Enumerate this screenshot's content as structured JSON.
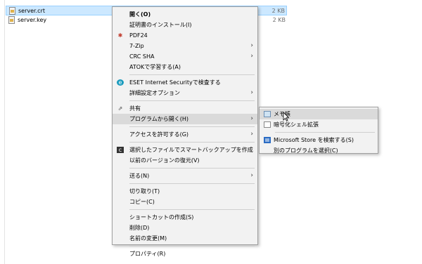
{
  "files": [
    {
      "name": "server.crt",
      "size": "2 KB",
      "selected": true
    },
    {
      "name": "server.key",
      "size": "2 KB",
      "selected": false
    }
  ],
  "menu": {
    "open": "開く(O)",
    "install_cert": "証明書のインストール(I)",
    "pdf24": "PDF24",
    "sevenzip": "7-Zip",
    "crc_sha": "CRC SHA",
    "atok": "ATOKで学習する(A)",
    "eset_scan": "ESET Internet Securityで検査する",
    "eset_advanced": "詳細設定オプション",
    "share": "共有",
    "open_with": "プログラムから開く(H)",
    "give_access": "アクセスを許可する(G)",
    "smart_backup": "選択したファイルでスマートバックアップを作成",
    "restore_versions": "以前のバージョンの復元(V)",
    "send_to": "送る(N)",
    "cut": "切り取り(T)",
    "copy": "コピー(C)",
    "create_shortcut": "ショートカットの作成(S)",
    "delete": "削除(D)",
    "rename": "名前の変更(M)",
    "properties": "プロパティ(R)"
  },
  "submenu": {
    "notepad": "メモ帳",
    "crypto_shell": "暗号化シェル拡張",
    "store_search": "Microsoft Store を検索する(S)",
    "choose_other": "別のプログラムを選択(C)"
  },
  "icons": {
    "submenu_arrow": "chevron-right-icon",
    "eset": "eset-icon",
    "pdf24": "pdf24-icon",
    "share": "share-icon",
    "backup": "backup-icon",
    "notepad": "notepad-icon",
    "document": "document-icon",
    "store": "store-icon"
  },
  "colors": {
    "selection": "#cce8ff",
    "menu_bg": "#f2f2f2",
    "menu_highlight": "#dadada"
  }
}
